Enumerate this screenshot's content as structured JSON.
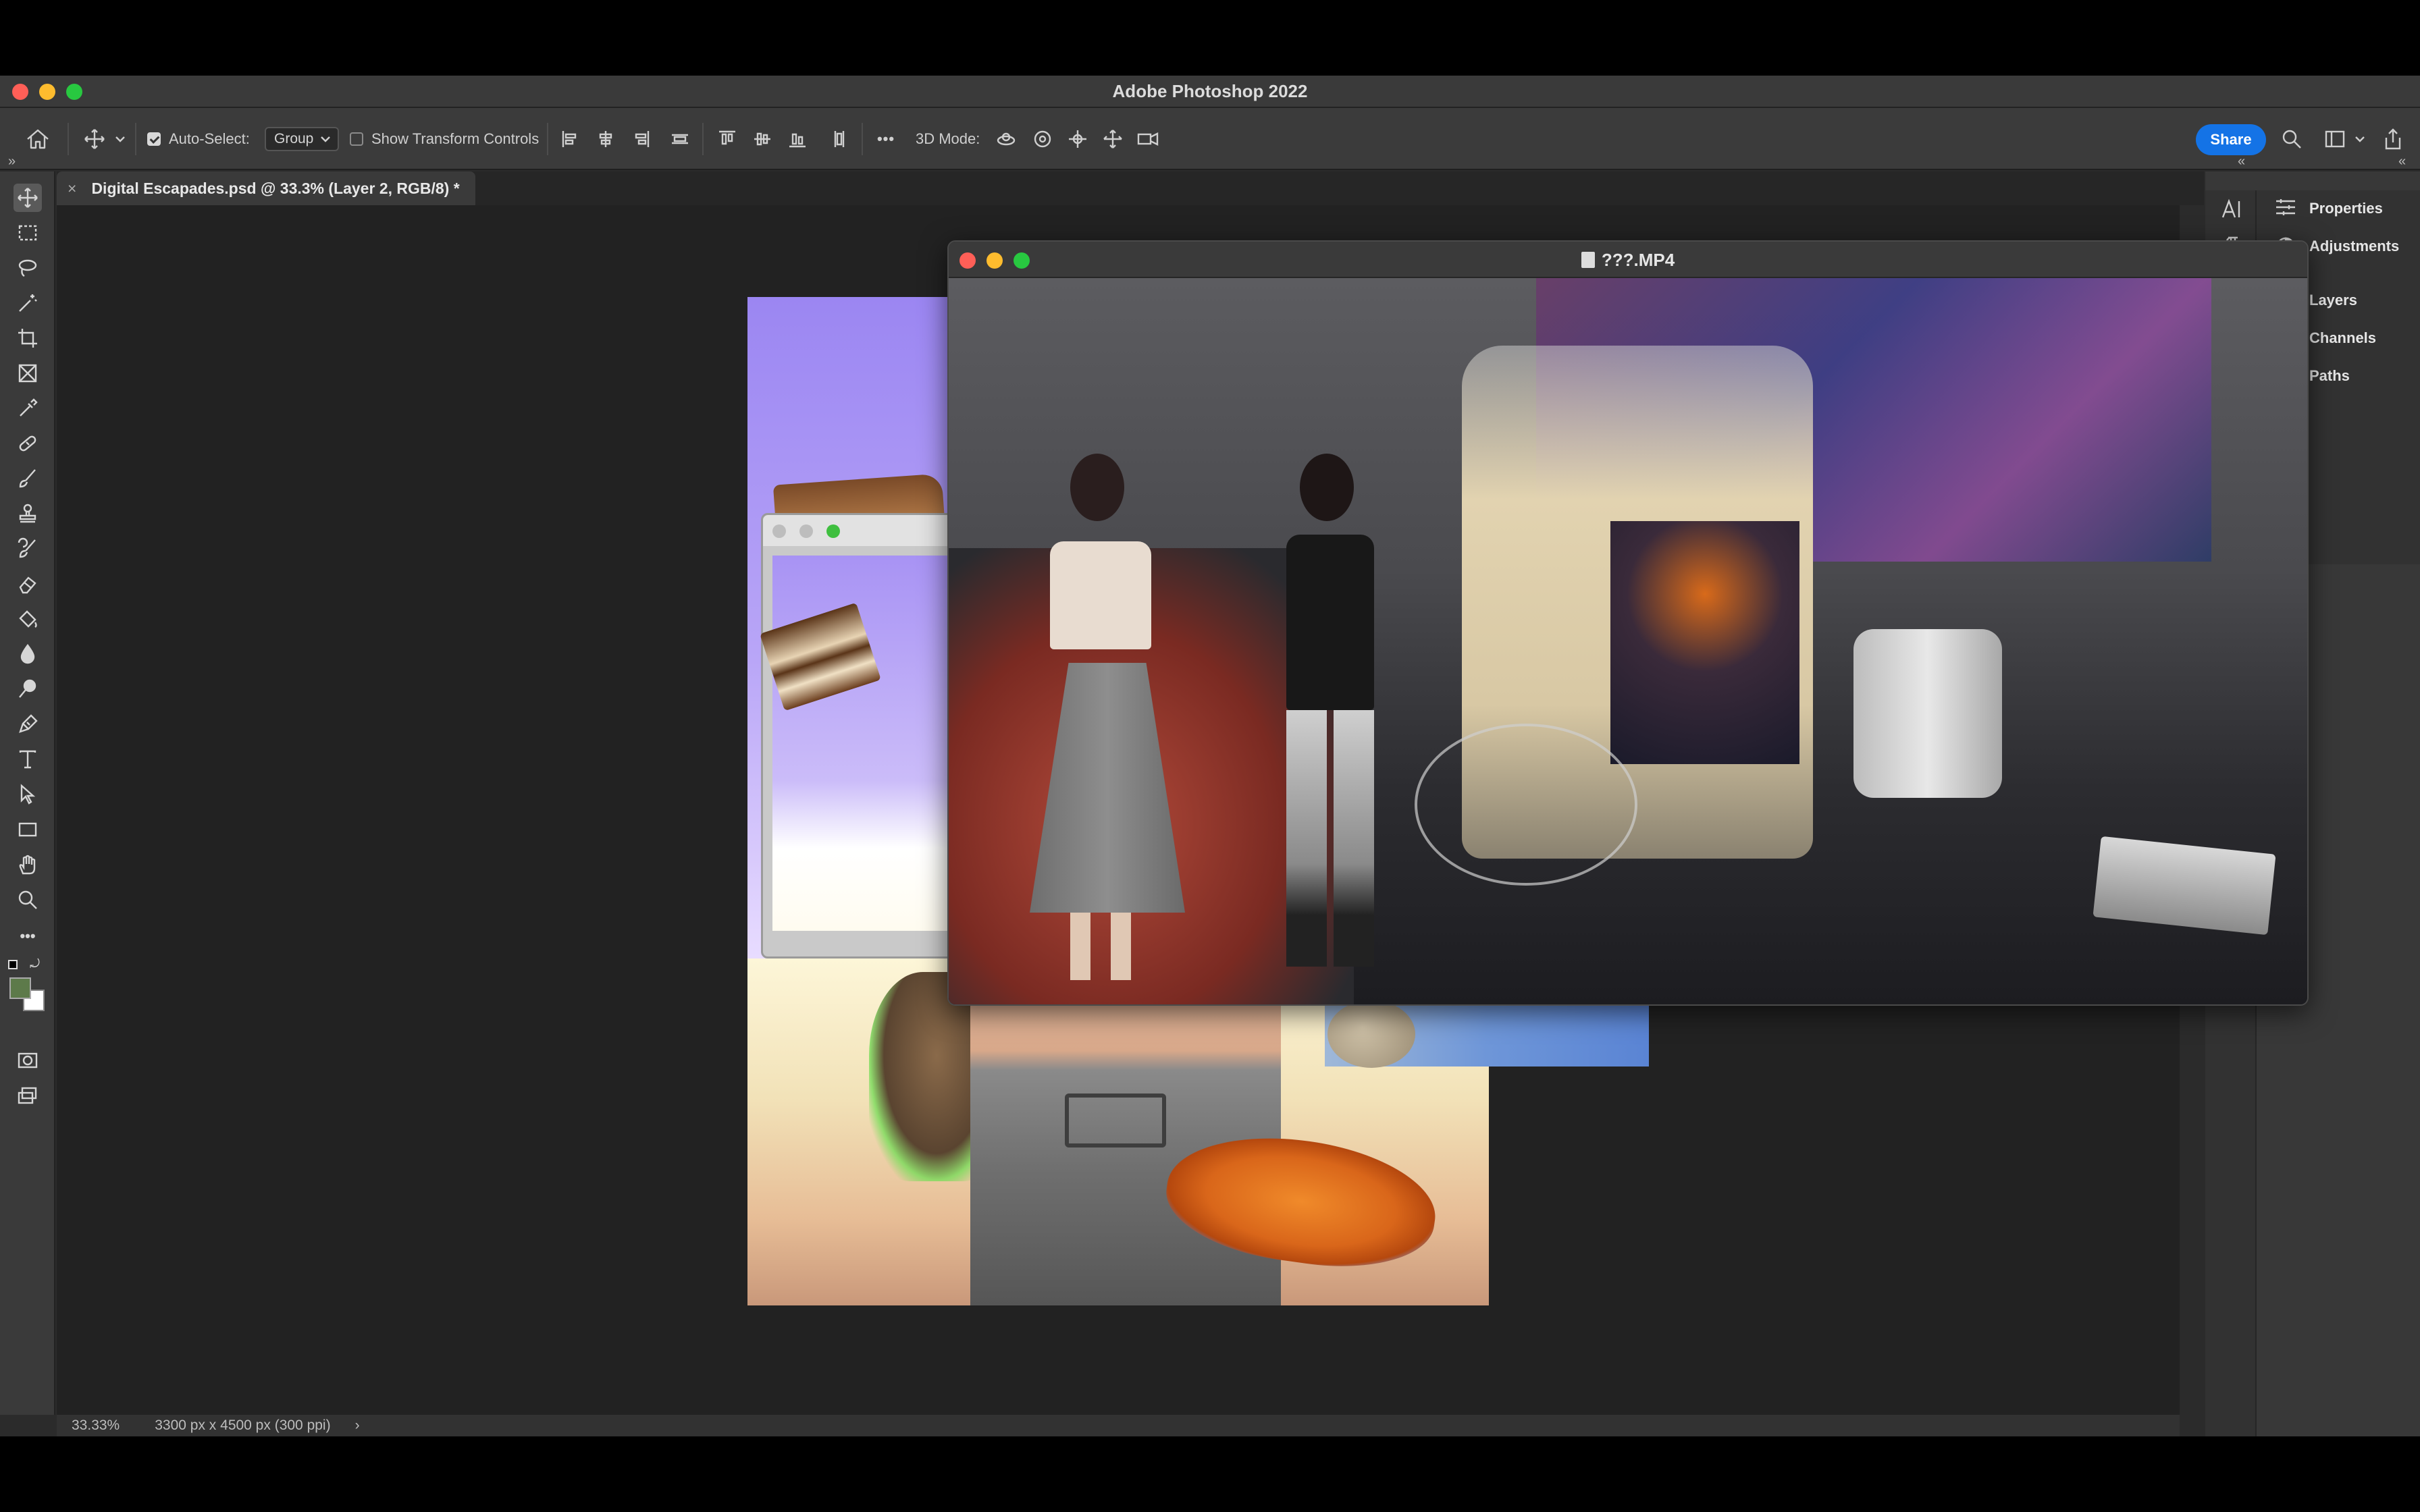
{
  "app": {
    "title": "Adobe Photoshop 2022"
  },
  "options_bar": {
    "auto_select_label": "Auto-Select:",
    "auto_select_checked": true,
    "auto_select_target": "Group",
    "show_transform_label": "Show Transform Controls",
    "show_transform_checked": false,
    "mode_3d_label": "3D Mode:",
    "more_label": "•••",
    "share_label": "Share"
  },
  "tab": {
    "close_glyph": "×",
    "title": "Digital Escapades.psd @ 33.3% (Layer 2, RGB/8) *"
  },
  "tools": [
    "move-icon",
    "marquee-icon",
    "lasso-icon",
    "magic-wand-icon",
    "crop-icon",
    "frame-icon",
    "eyedropper-icon",
    "healing-brush-icon",
    "brush-icon",
    "clone-stamp-icon",
    "history-brush-icon",
    "eraser-icon",
    "paint-bucket-icon",
    "blur-icon",
    "dodge-icon",
    "pen-icon",
    "type-icon",
    "path-selection-icon",
    "rectangle-icon",
    "hand-icon",
    "zoom-icon",
    "more-tools-icon"
  ],
  "colors": {
    "foreground": "#5d7a4a",
    "background": "#ffffff",
    "accent": "#1473e6"
  },
  "panels": {
    "properties": "Properties",
    "adjustments": "Adjustments",
    "layers": "Layers",
    "channels": "Channels",
    "paths": "Paths"
  },
  "video_window": {
    "title": "???.MP4"
  },
  "status": {
    "zoom": "33.33%",
    "doc_info": "3300 px x 4500 px (300 ppi)",
    "arrow": "›"
  }
}
